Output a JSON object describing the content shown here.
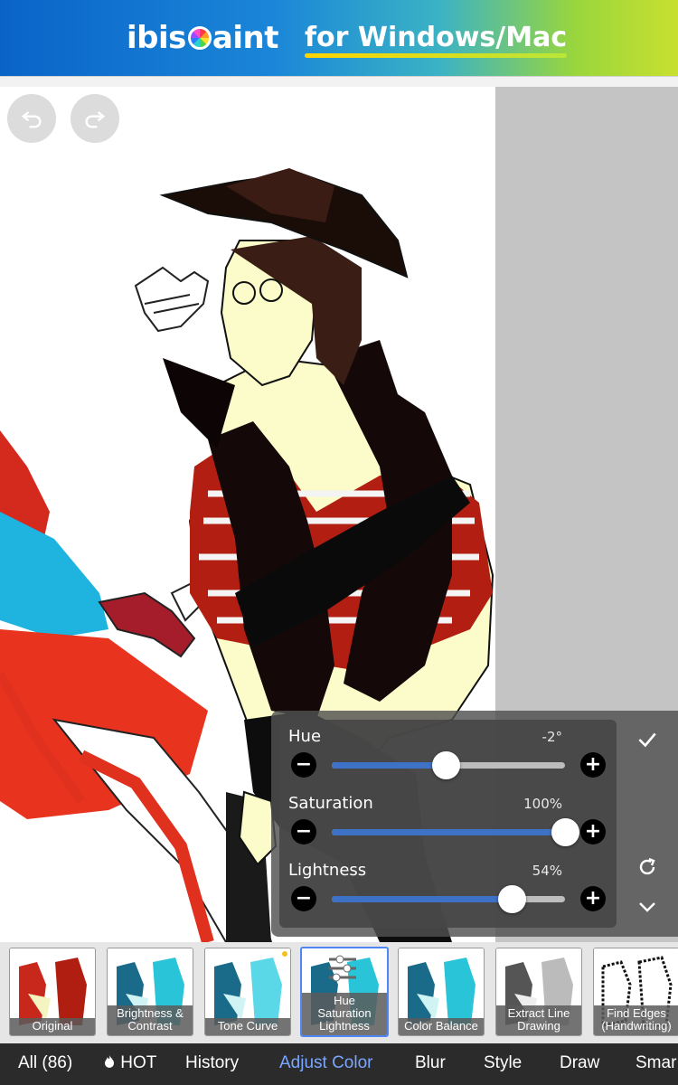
{
  "banner": {
    "logo_left": "ibis",
    "logo_right": "aint",
    "tagline": "for Windows/Mac"
  },
  "toolbar": {
    "undo_icon": "undo-arrow-icon",
    "redo_icon": "redo-arrow-icon"
  },
  "adjust_panel": {
    "sliders": [
      {
        "label": "Hue",
        "value_text": "-2°",
        "fraction": 0.49
      },
      {
        "label": "Saturation",
        "value_text": "100%",
        "fraction": 1.0
      },
      {
        "label": "Lightness",
        "value_text": "54%",
        "fraction": 0.77
      }
    ],
    "minus_symbol": "−",
    "plus_symbol": "+",
    "confirm_icon": "checkmark-icon",
    "reset_icon": "refresh-icon",
    "collapse_icon": "chevron-down-icon"
  },
  "filters": [
    {
      "label": "Original"
    },
    {
      "label": "Brightness &\nContrast"
    },
    {
      "label": "Tone Curve"
    },
    {
      "label": "Hue\nSaturation\nLightness",
      "selected": true
    },
    {
      "label": "Color Balance"
    },
    {
      "label": "Extract Line\nDrawing"
    },
    {
      "label": "Find Edges\n(Handwriting)"
    }
  ],
  "tabs": [
    {
      "label": "All (86)"
    },
    {
      "label": "HOT",
      "icon": "flame-icon"
    },
    {
      "label": "History"
    },
    {
      "label": "Adjust Color",
      "active": true
    },
    {
      "label": "Blur"
    },
    {
      "label": "Style"
    },
    {
      "label": "Draw"
    },
    {
      "label": "Smar"
    }
  ],
  "colors": {
    "accent": "#3e72c6",
    "active_tab": "#7aa6ff",
    "tabbar_bg": "#2b2b2b"
  }
}
